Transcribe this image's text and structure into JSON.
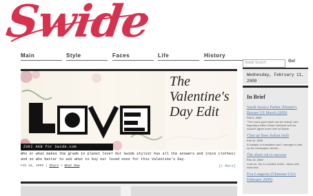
{
  "brand": {
    "logo_text": "Swide",
    "color": "#d6324f"
  },
  "nav": {
    "items": [
      {
        "label": "Main"
      },
      {
        "label": "Style"
      },
      {
        "label": "Faces"
      },
      {
        "label": "Life"
      },
      {
        "label": "History"
      }
    ]
  },
  "search": {
    "placeholder": "Swide Search",
    "button": "Go!"
  },
  "date": {
    "text": "Wednesday, February 11, 2009"
  },
  "feature": {
    "headline_lines": [
      "The",
      "Valentine's",
      "Day Edit"
    ],
    "art_word": "LOVE",
    "credit": "ZUKI AKB for Swide.com",
    "text": "Who or what makes the grade in planet love? Our Swide stylist has all the answers and (nice clothes) and so who better to ask what to buy our loved ones for this Valentine's Day.",
    "meta": {
      "date": "Feb 10, 2009",
      "share": "Share",
      "whats_new": "What New",
      "more": "[+ More]"
    }
  },
  "sidebar": {
    "heading": "In Brief",
    "items": [
      {
        "title": "Sarah Jessica Parker (Harper's Bazaar US March 2009)",
        "date": "Feb 9, 2009",
        "snippet": "\"The much-good taste can be boring\" said legendary editor Diana Vreeland and we couldn't agree more here at Swide."
      },
      {
        "title": "Chat up lines Italian style",
        "date": "Feb 11, 2009",
        "snippet": "A mistake or translation and I manage to chat up the newspaper vendor...."
      },
      {
        "title": "The short cut to success",
        "date": "Feb 10, 2009",
        "snippet": "Look us, Sq, is a limited series - dress well, work less."
      },
      {
        "title": "Eva Longoria (Glamour USA February 2009)",
        "date": "",
        "snippet": ""
      }
    ]
  }
}
